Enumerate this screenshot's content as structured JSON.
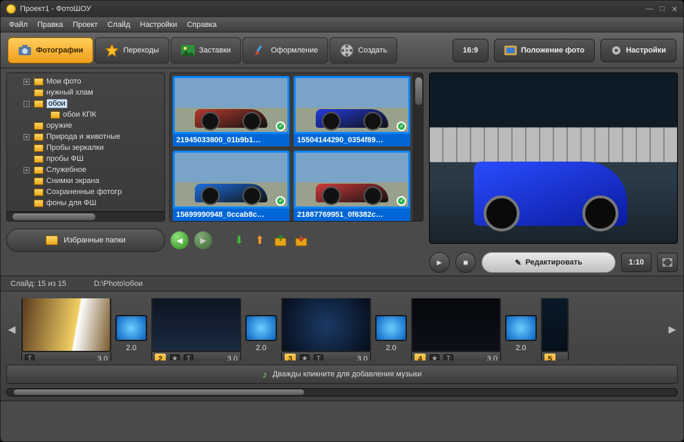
{
  "window": {
    "title": "Проект1 - ФотоШОУ"
  },
  "menu": [
    "Файл",
    "Правка",
    "Проект",
    "Слайд",
    "Настройки",
    "Справка"
  ],
  "tabs": {
    "photos": {
      "label": "Фотографии"
    },
    "trans": {
      "label": "Переходы"
    },
    "splash": {
      "label": "Заставки"
    },
    "design": {
      "label": "Оформление"
    },
    "create": {
      "label": "Создать"
    }
  },
  "toolbar_right": {
    "aspect": {
      "label": "16:9"
    },
    "fit": {
      "label": "Положение фото"
    },
    "settings": {
      "label": "Настройки"
    }
  },
  "tree": {
    "items": [
      {
        "exp": "+",
        "label": "Мои фото"
      },
      {
        "exp": "",
        "label": "нужный хлам"
      },
      {
        "exp": "-",
        "label": "обои",
        "selected": true
      },
      {
        "exp": "",
        "label": "обои КПК",
        "child": true
      },
      {
        "exp": "",
        "label": "оружие"
      },
      {
        "exp": "+",
        "label": "Природа и животные"
      },
      {
        "exp": "",
        "label": "Пробы зеркалки"
      },
      {
        "exp": "",
        "label": "пробы ФШ"
      },
      {
        "exp": "+",
        "label": "Служебное"
      },
      {
        "exp": "",
        "label": "Снимки экрана"
      },
      {
        "exp": "",
        "label": "Сохраненные фотогр"
      },
      {
        "exp": "",
        "label": "фоны для ФШ"
      }
    ]
  },
  "thumbs": [
    {
      "caption": "21945033800_01b9b1…",
      "car": "#b43a2e"
    },
    {
      "caption": "15504144290_0354f89…",
      "car": "#223bdf"
    },
    {
      "caption": "15699990948_0ccab8c…",
      "car": "#1e6fe0"
    },
    {
      "caption": "21887769951_0f6382c…",
      "car": "#cf3a3a"
    }
  ],
  "fav_button": {
    "label": "Избранные папки"
  },
  "edit_button": {
    "label": "Редактировать"
  },
  "preview": {
    "time": "1:10"
  },
  "status": {
    "slide_counter": "Слайд: 15 из 15",
    "path": "D:\\Photo\\обои"
  },
  "timeline": {
    "music_hint": "Дважды кликните для добавления музыки",
    "slides": [
      {
        "num": "",
        "dur": "3.0",
        "trans_dur": "2.0",
        "noNum": true
      },
      {
        "num": "2",
        "dur": "3.0",
        "trans_dur": "2.0"
      },
      {
        "num": "3",
        "dur": "3.0",
        "trans_dur": "2.0"
      },
      {
        "num": "4",
        "dur": "3.0",
        "trans_dur": "2.0"
      },
      {
        "num": "5",
        "dur": "",
        "last": true
      }
    ]
  }
}
